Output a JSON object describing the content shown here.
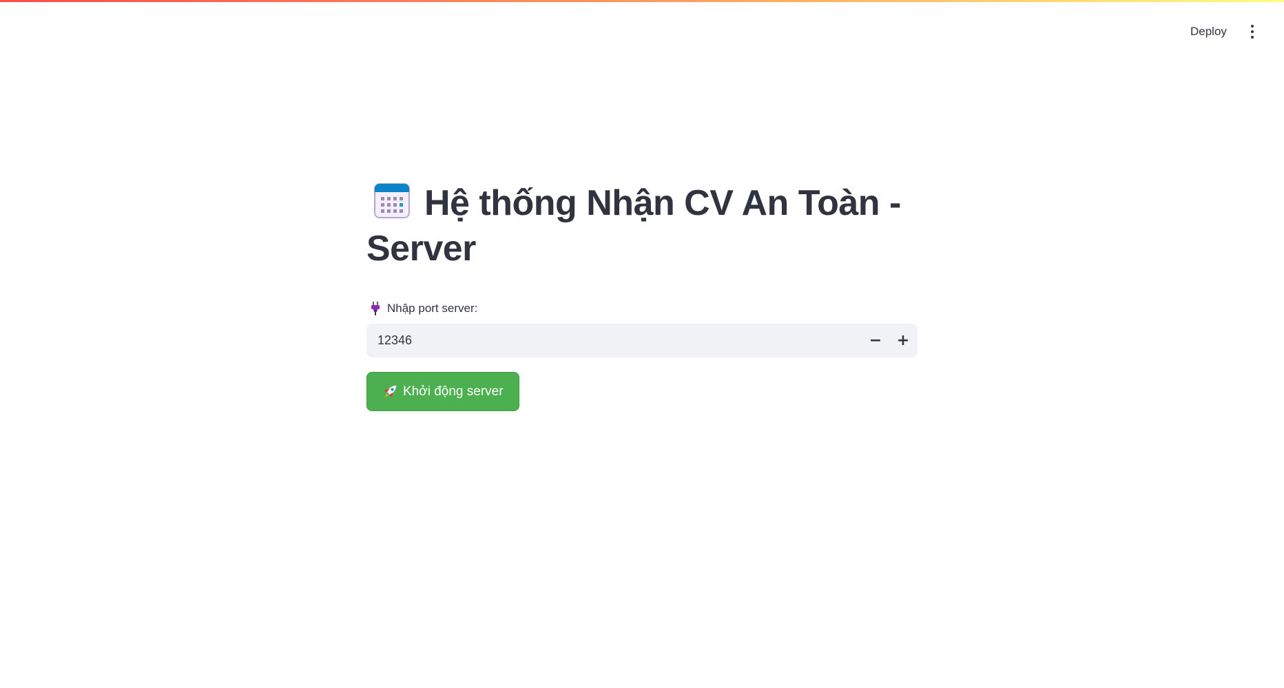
{
  "header": {
    "deploy_label": "Deploy",
    "menu_icon": "kebab-menu-icon"
  },
  "main": {
    "title_icon": "calendar-icon",
    "title": "Hệ thống Nhận CV An Toàn - Server",
    "port_field": {
      "label_icon": "plug-icon",
      "label": "Nhập port server:",
      "value": "12346",
      "decrement_label": "−",
      "increment_label": "+"
    },
    "start_button": {
      "icon": "rocket-icon",
      "label": "Khởi động server"
    }
  },
  "colors": {
    "accent_gradient": [
      "#ff4b4b",
      "#ffa15e",
      "#fffd80"
    ],
    "primary_button": "#4caf50",
    "input_background": "#f0f2f6",
    "text": "#31333f"
  }
}
